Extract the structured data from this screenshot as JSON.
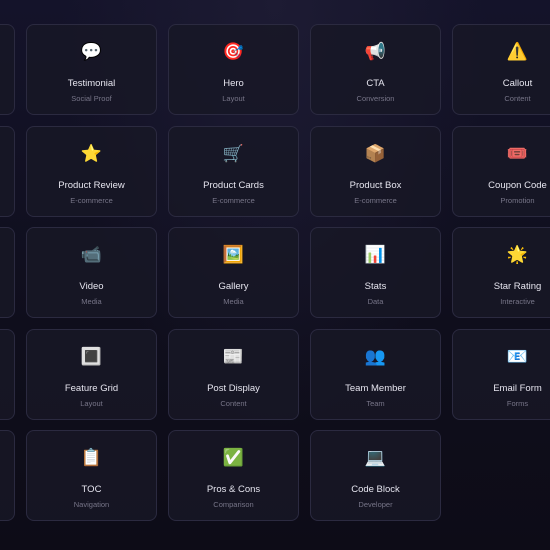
{
  "rows": [
    [
      {
        "name": "",
        "category": "",
        "icon": "",
        "icon_name": "hidden-card-icon"
      },
      {
        "name": "Testimonial",
        "category": "Social Proof",
        "icon": "💬",
        "icon_name": "speech-bubble-icon"
      },
      {
        "name": "Hero",
        "category": "Layout",
        "icon": "🎯",
        "icon_name": "target-icon"
      },
      {
        "name": "CTA",
        "category": "Conversion",
        "icon": "📢",
        "icon_name": "megaphone-icon"
      },
      {
        "name": "Callout",
        "category": "Content",
        "icon": "⚠️",
        "icon_name": "warning-icon"
      }
    ],
    [
      {
        "name": "",
        "category": "",
        "icon": "",
        "icon_name": "hidden-card-icon"
      },
      {
        "name": "Product Review",
        "category": "E-commerce",
        "icon": "⭐",
        "icon_name": "star-icon"
      },
      {
        "name": "Product Cards",
        "category": "E-commerce",
        "icon": "🛒",
        "icon_name": "shopping-cart-icon"
      },
      {
        "name": "Product Box",
        "category": "E-commerce",
        "icon": "📦",
        "icon_name": "package-icon"
      },
      {
        "name": "Coupon Code",
        "category": "Promotion",
        "icon": "🎟️",
        "icon_name": "ticket-icon"
      }
    ],
    [
      {
        "name": "",
        "category": "",
        "icon": "",
        "icon_name": "hidden-card-icon"
      },
      {
        "name": "Video",
        "category": "Media",
        "icon": "📹",
        "icon_name": "video-camera-icon"
      },
      {
        "name": "Gallery",
        "category": "Media",
        "icon": "🖼️",
        "icon_name": "framed-picture-icon"
      },
      {
        "name": "Stats",
        "category": "Data",
        "icon": "📊",
        "icon_name": "bar-chart-icon"
      },
      {
        "name": "Star Rating",
        "category": "Interactive",
        "icon": "🌟",
        "icon_name": "glowing-star-icon"
      }
    ],
    [
      {
        "name": "",
        "category": "",
        "icon": "",
        "icon_name": "hidden-card-icon"
      },
      {
        "name": "Feature Grid",
        "category": "Layout",
        "icon": "🔳",
        "icon_name": "square-button-icon"
      },
      {
        "name": "Post Display",
        "category": "Content",
        "icon": "📰",
        "icon_name": "newspaper-icon"
      },
      {
        "name": "Team Member",
        "category": "Team",
        "icon": "👥",
        "icon_name": "people-icon"
      },
      {
        "name": "Email Form",
        "category": "Forms",
        "icon": "📧",
        "icon_name": "email-icon"
      }
    ],
    [
      {
        "name": "",
        "category": "",
        "icon": "",
        "icon_name": "hidden-card-icon"
      },
      {
        "name": "TOC",
        "category": "Navigation",
        "icon": "📋",
        "icon_name": "clipboard-icon"
      },
      {
        "name": "Pros & Cons",
        "category": "Comparison",
        "icon": "✅",
        "icon_name": "check-mark-icon"
      },
      {
        "name": "Code Block",
        "category": "Developer",
        "icon": "💻",
        "icon_name": "laptop-icon"
      }
    ]
  ]
}
